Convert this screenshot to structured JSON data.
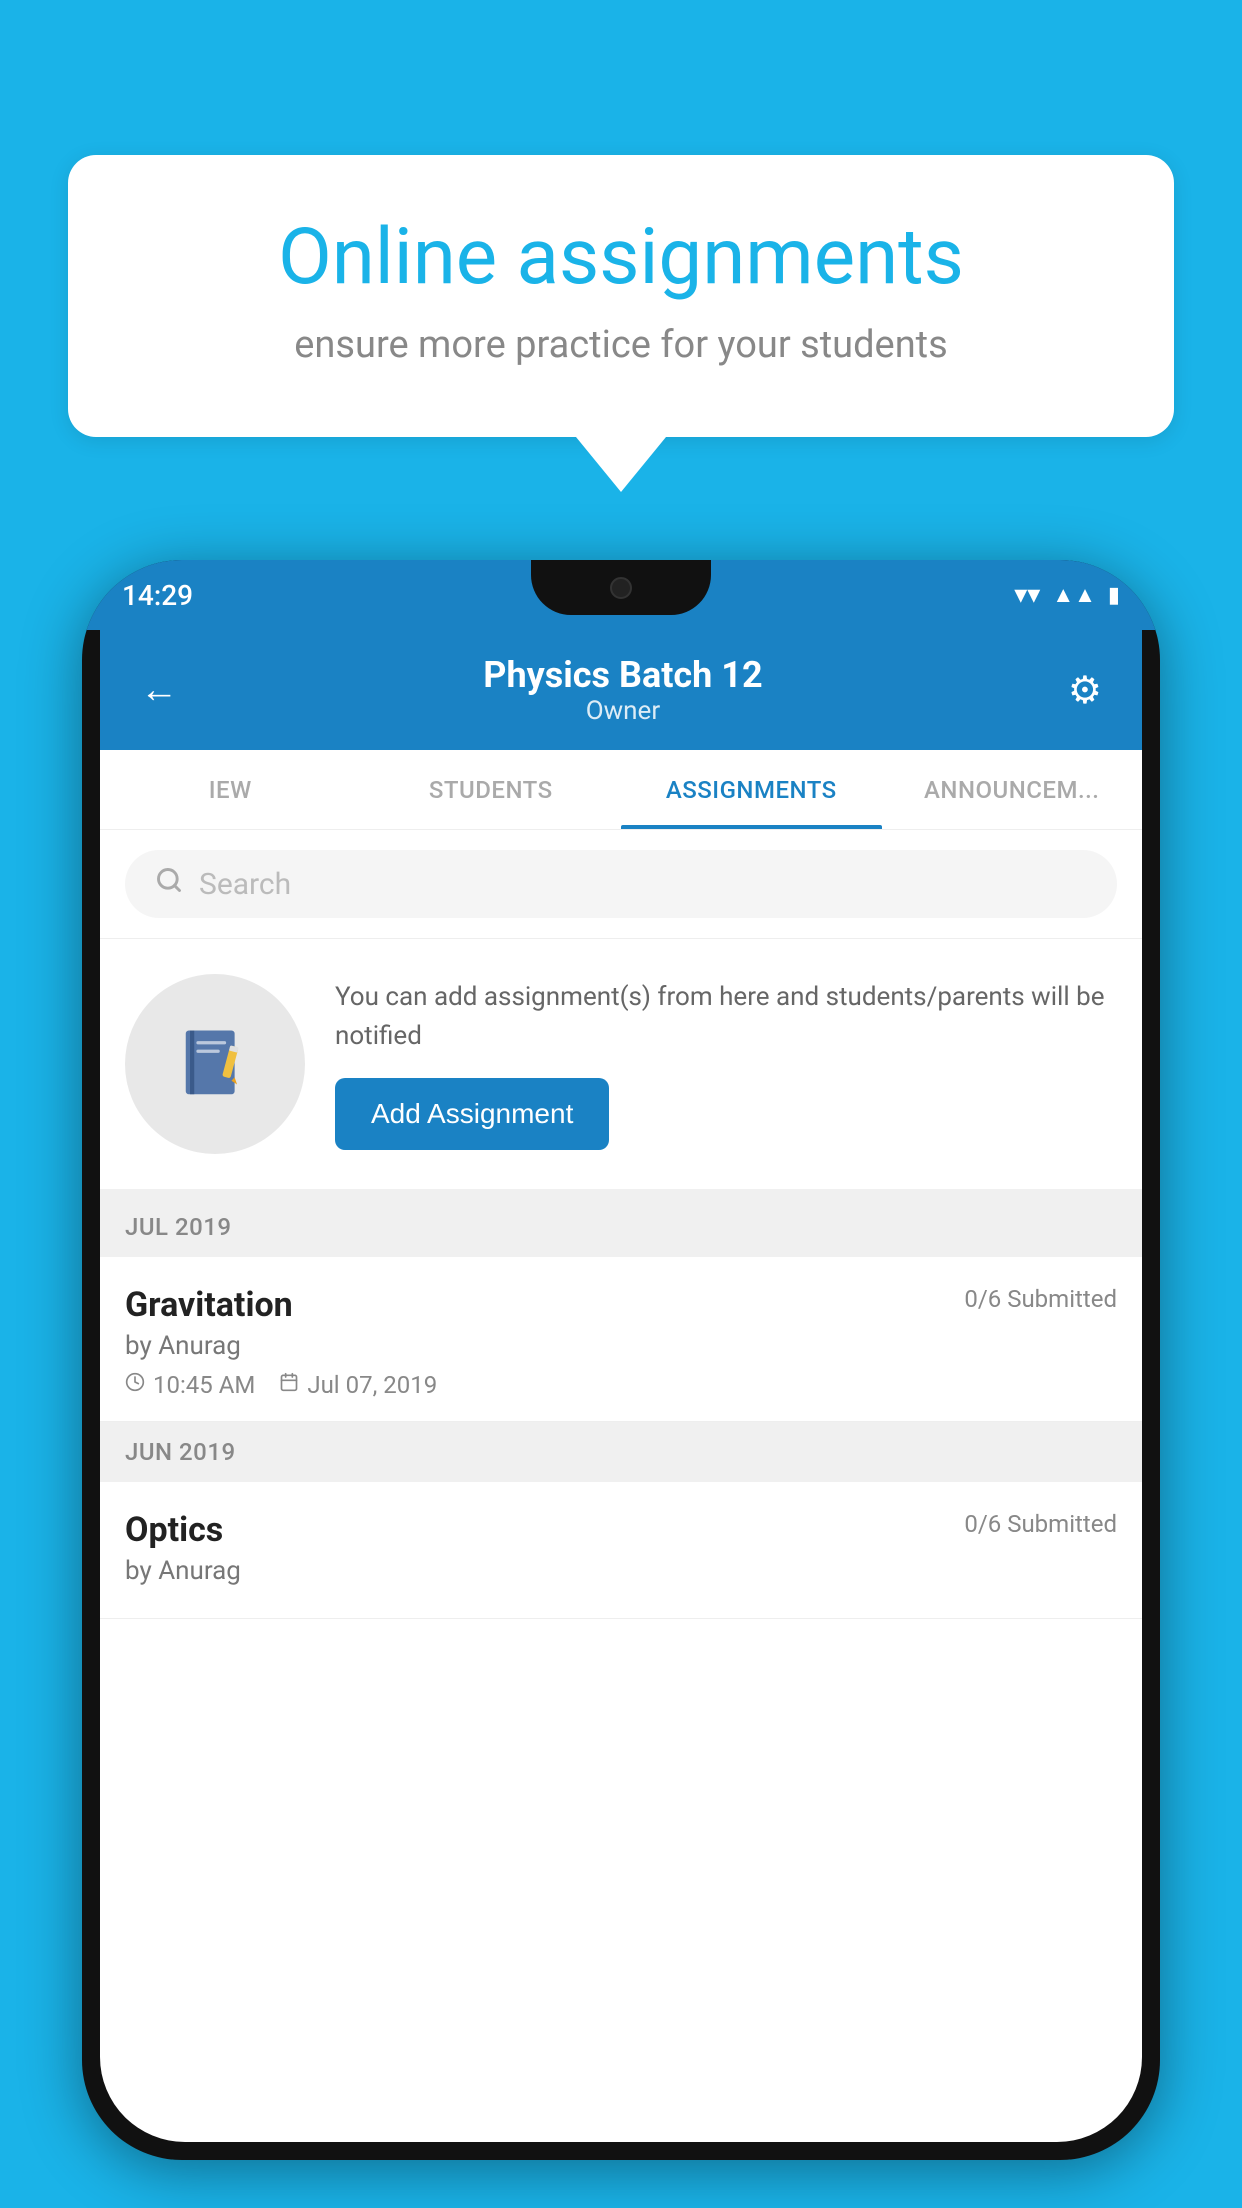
{
  "background_color": "#1ab3e8",
  "speech_bubble": {
    "title": "Online assignments",
    "subtitle": "ensure more practice for your students"
  },
  "phone": {
    "status_bar": {
      "time": "14:29",
      "wifi_icon": "wifi",
      "signal_icon": "signal",
      "battery_icon": "battery"
    },
    "header": {
      "back_label": "←",
      "title": "Physics Batch 12",
      "subtitle": "Owner",
      "settings_icon": "⚙"
    },
    "tabs": [
      {
        "label": "IEW",
        "active": false
      },
      {
        "label": "STUDENTS",
        "active": false
      },
      {
        "label": "ASSIGNMENTS",
        "active": true
      },
      {
        "label": "ANNOUNCEM...",
        "active": false
      }
    ],
    "search": {
      "placeholder": "Search"
    },
    "promo_card": {
      "description": "You can add assignment(s) from here and students/parents will be notified",
      "button_label": "Add Assignment"
    },
    "sections": [
      {
        "month_label": "JUL 2019",
        "assignments": [
          {
            "name": "Gravitation",
            "submitted": "0/6 Submitted",
            "by": "by Anurag",
            "time": "10:45 AM",
            "date": "Jul 07, 2019"
          }
        ]
      },
      {
        "month_label": "JUN 2019",
        "assignments": [
          {
            "name": "Optics",
            "submitted": "0/6 Submitted",
            "by": "by Anurag",
            "time": "",
            "date": ""
          }
        ]
      }
    ]
  }
}
